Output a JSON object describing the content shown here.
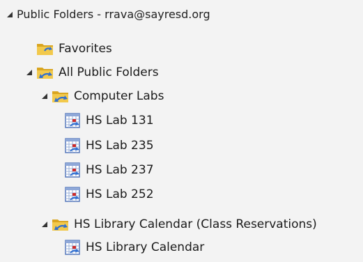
{
  "root": {
    "label": "Public Folders - rrava@sayresd.org",
    "expanded": true
  },
  "favorites": {
    "label": "Favorites",
    "icon": "folder-icon"
  },
  "all_public_folders": {
    "label": "All Public Folders",
    "icon": "public-folder-icon",
    "expanded": true
  },
  "computer_labs": {
    "label": "Computer Labs",
    "icon": "public-folder-icon",
    "expanded": true,
    "items": [
      {
        "label": "HS Lab 131",
        "icon": "calendar-icon"
      },
      {
        "label": "HS Lab 235",
        "icon": "calendar-icon"
      },
      {
        "label": "HS Lab 237",
        "icon": "calendar-icon"
      },
      {
        "label": "HS Lab 252",
        "icon": "calendar-icon"
      }
    ]
  },
  "library": {
    "label": "HS Library Calendar (Class Reservations)",
    "icon": "public-folder-icon",
    "expanded": true,
    "items": [
      {
        "label": "HS Library Calendar",
        "icon": "calendar-icon"
      }
    ]
  },
  "colors": {
    "background": "#f3f3f3",
    "folder_yellow": "#f2c94c",
    "folder_dark": "#d9a520",
    "arrow_blue": "#2f6fd1",
    "calendar_border": "#5577bb",
    "calendar_red": "#cc2a2a"
  }
}
